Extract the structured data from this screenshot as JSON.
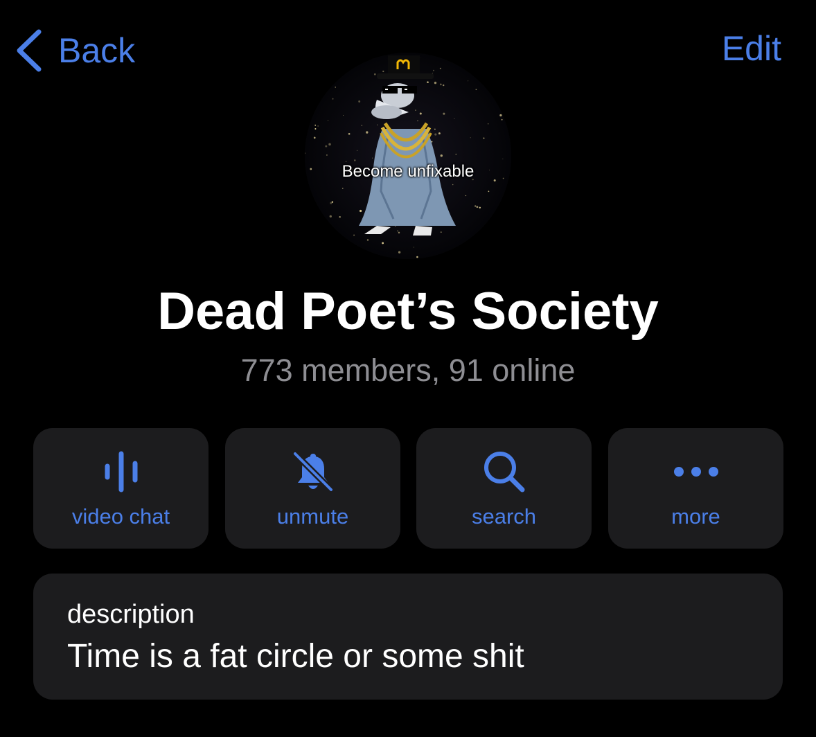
{
  "nav": {
    "back_label": "Back",
    "edit_label": "Edit"
  },
  "profile": {
    "avatar_caption": "Become unfixable",
    "title": "Dead Poet’s Society",
    "subtitle": "773 members, 91 online"
  },
  "actions": [
    {
      "label": "video chat",
      "icon": "voice-chat-icon"
    },
    {
      "label": "unmute",
      "icon": "bell-slash-icon"
    },
    {
      "label": "search",
      "icon": "search-icon"
    },
    {
      "label": "more",
      "icon": "ellipsis-icon"
    }
  ],
  "description": {
    "label": "description",
    "text": "Time is a fat circle or some shit"
  },
  "colors": {
    "accent": "#4b7fe8",
    "background": "#000000",
    "card": "#1c1c1e",
    "secondary_text": "#8e8e93"
  }
}
